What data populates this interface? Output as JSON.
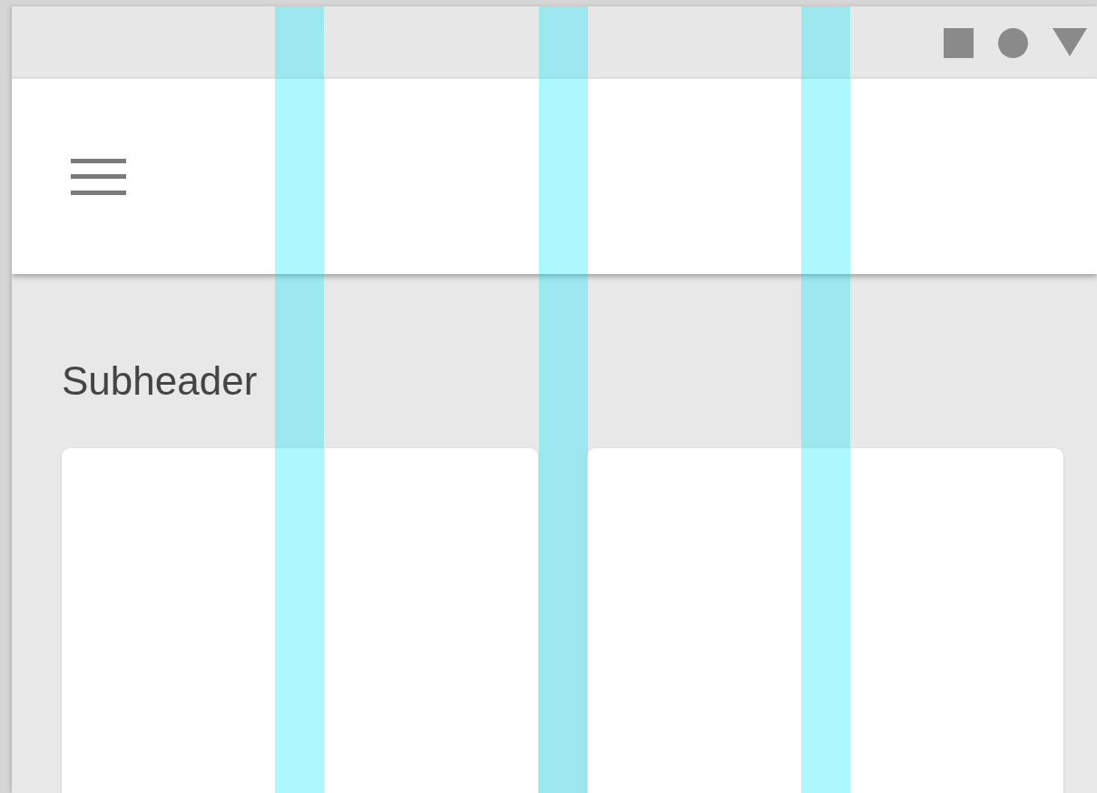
{
  "status_bar": {
    "icons": [
      {
        "kind": "square"
      },
      {
        "kind": "circle"
      },
      {
        "kind": "triangle"
      }
    ]
  },
  "app_bar": {
    "menu_button": {
      "kind": "menu"
    }
  },
  "subheader": "Subheader",
  "cards": [
    {
      "kind": "card"
    },
    {
      "kind": "card"
    }
  ],
  "grid_overlay": {
    "shown": true
  }
}
